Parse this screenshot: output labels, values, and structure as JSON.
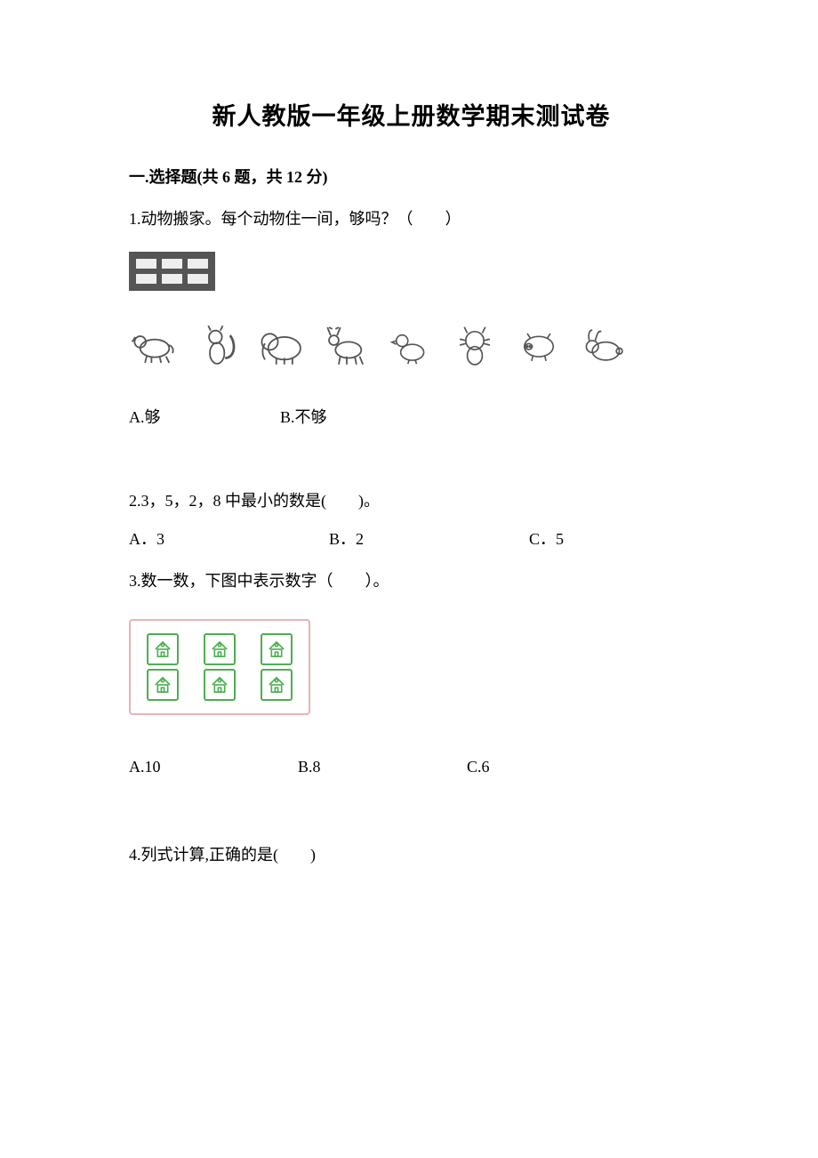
{
  "title": "新人教版一年级上册数学期末测试卷",
  "section1": {
    "heading": "一.选择题(共 6 题，共 12 分)"
  },
  "q1": {
    "text": "1.动物搬家。每个动物住一间，够吗？（　　）",
    "optA": "A.够",
    "optB": "B.不够"
  },
  "q2": {
    "text": "2.3，5，2，8 中最小的数是(　　)。",
    "optA": "A．3",
    "optB": "B．2",
    "optC": "C．5"
  },
  "q3": {
    "text": "3.数一数，下图中表示数字（　　）。",
    "optA": "A.10",
    "optB": "B.8",
    "optC": "C.6"
  },
  "q4": {
    "text": "4.列式计算,正确的是(　　)"
  }
}
